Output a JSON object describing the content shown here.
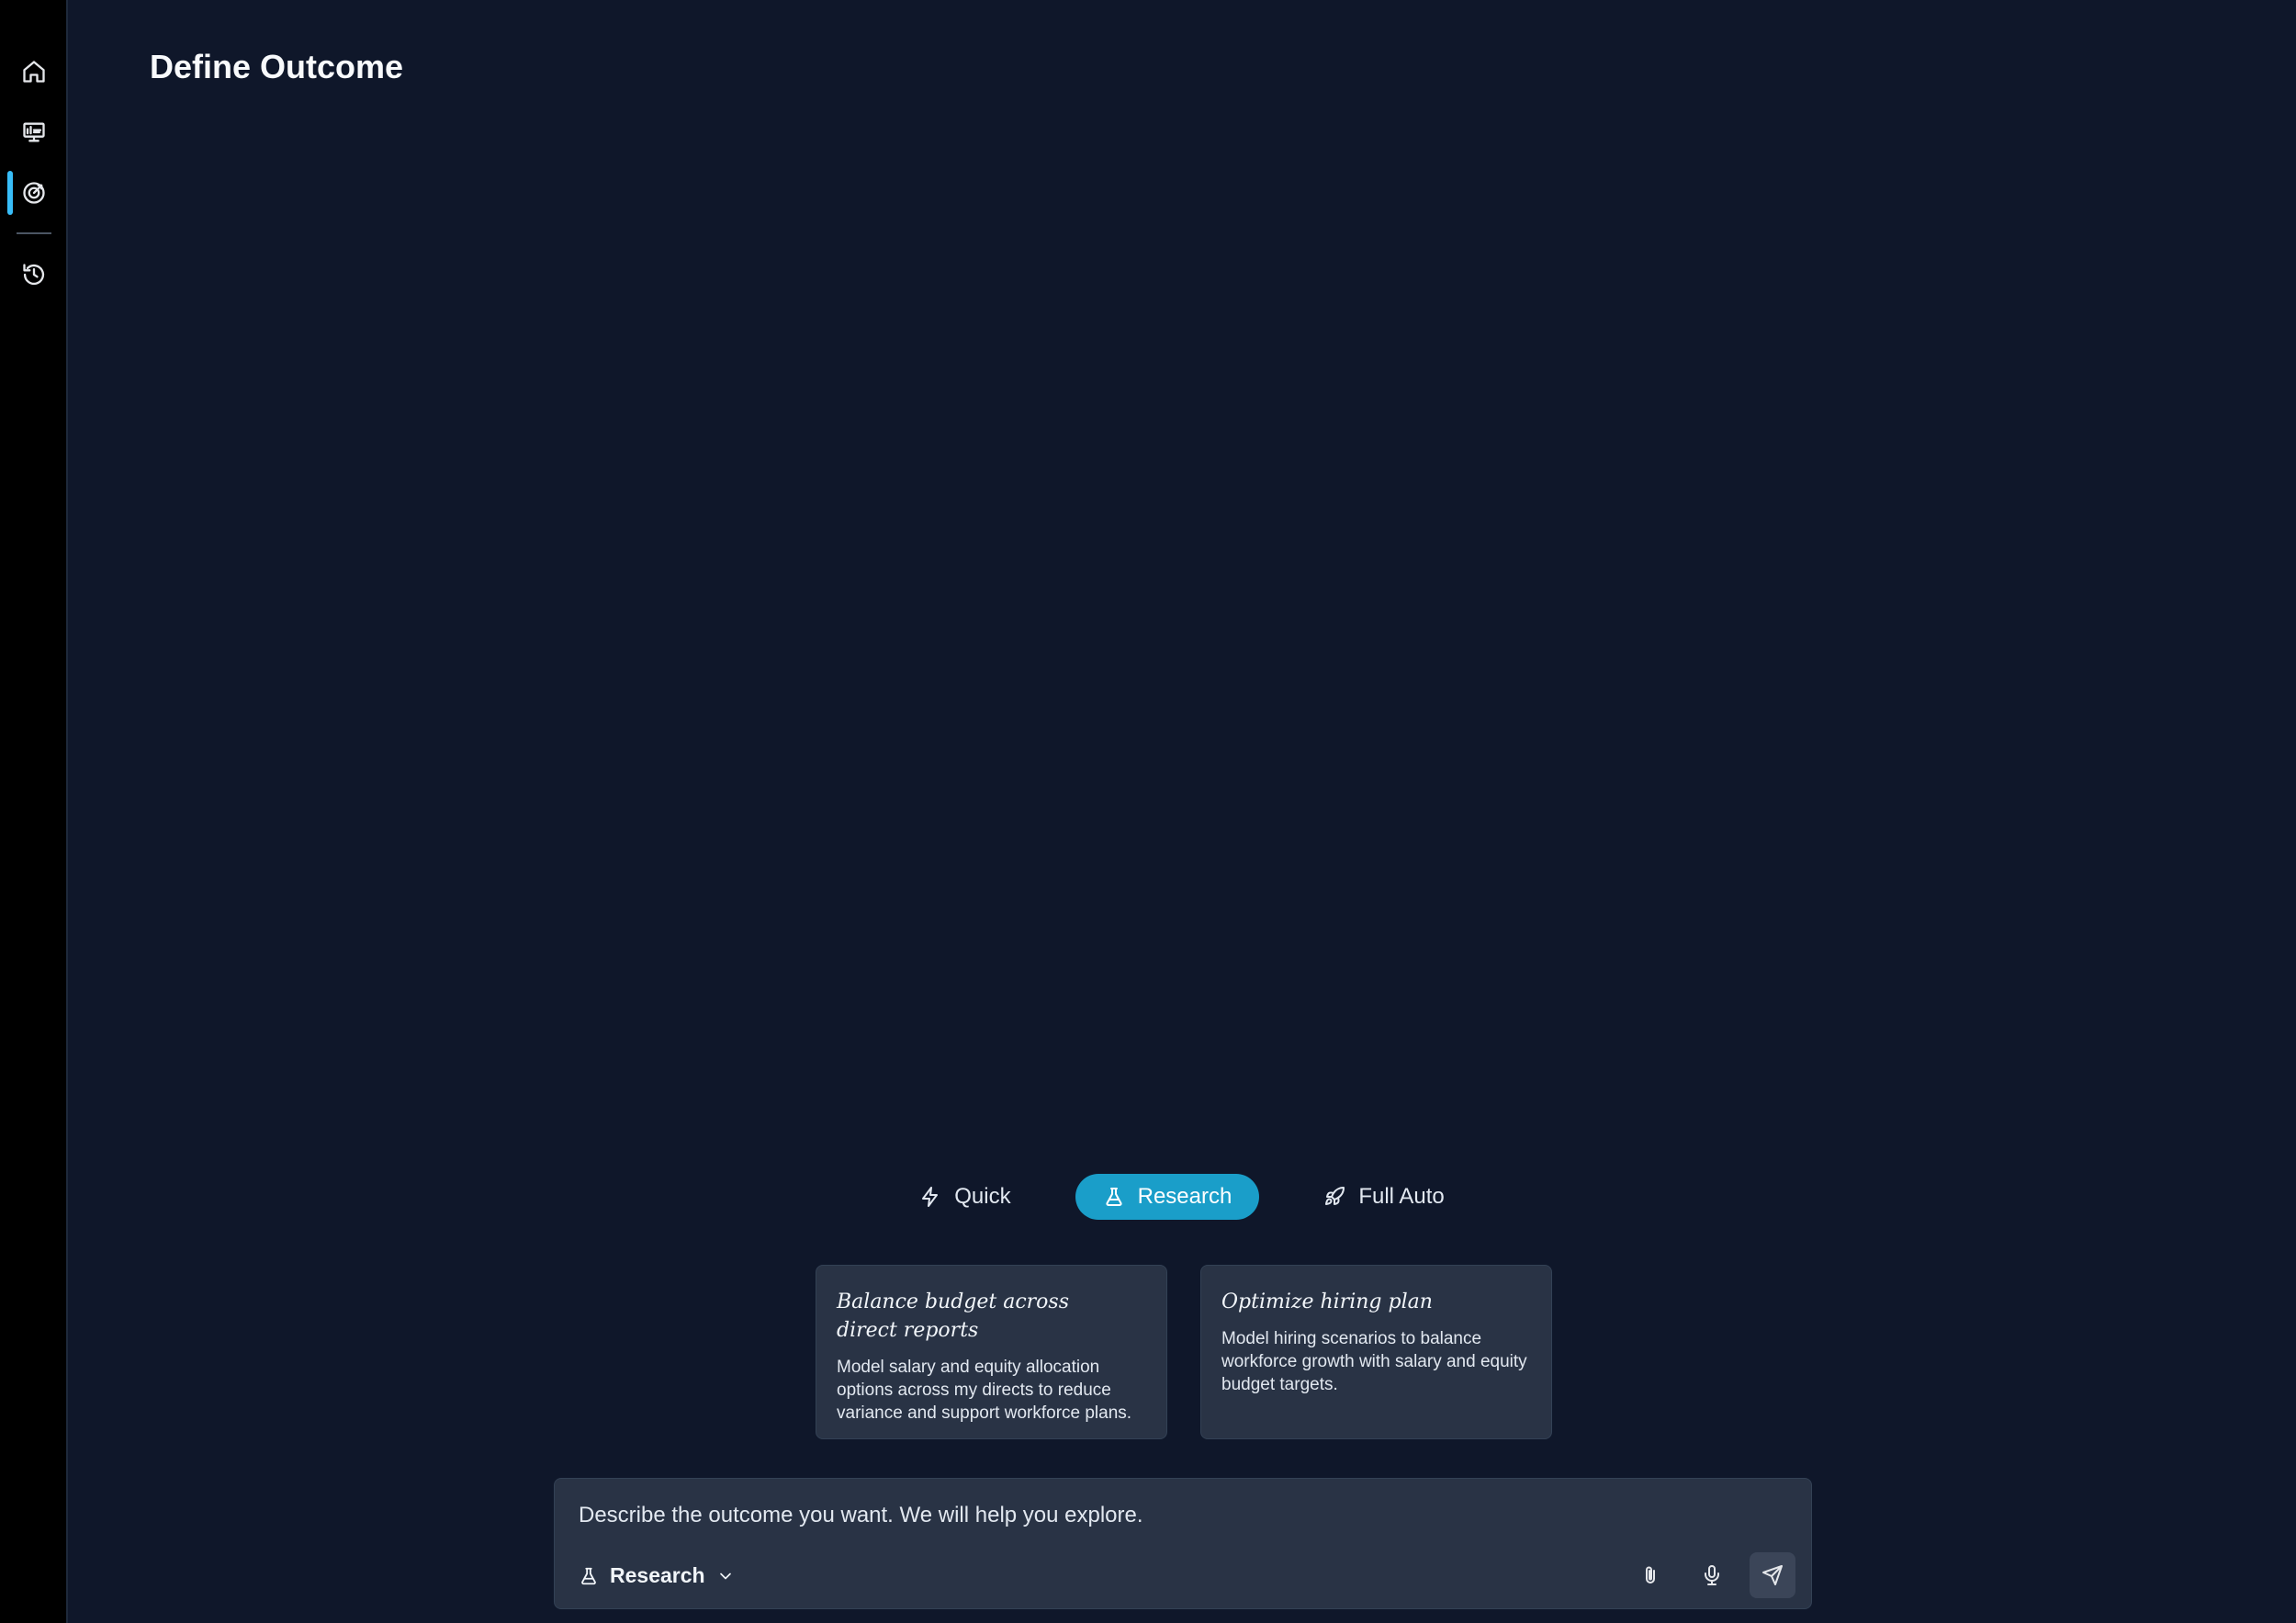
{
  "page": {
    "title": "Define Outcome"
  },
  "sidebar": {
    "items": [
      {
        "icon": "home-icon",
        "active": false
      },
      {
        "icon": "dashboard-icon",
        "active": false
      },
      {
        "icon": "target-icon",
        "active": true
      },
      {
        "icon": "history-icon",
        "active": false
      }
    ]
  },
  "modes": {
    "selected": "Research",
    "items": [
      {
        "label": "Quick",
        "icon": "lightning-icon"
      },
      {
        "label": "Research",
        "icon": "flask-icon"
      },
      {
        "label": "Full Auto",
        "icon": "rocket-icon"
      }
    ]
  },
  "suggestions": [
    {
      "title_line1": "Balance budget across",
      "title_line2": "direct reports",
      "description": "Model salary and equity allocation options across my directs to reduce variance and support workforce plans."
    },
    {
      "title_line1": "Optimize hiring plan",
      "title_line2": "",
      "description": "Model hiring scenarios to balance workforce growth with salary and equity budget targets."
    }
  ],
  "composer": {
    "placeholder": "Describe the outcome you want. We will help you explore.",
    "mode_label": "Research"
  },
  "colors": {
    "background": "#0f172a",
    "sidebar": "#000000",
    "accent": "#1a9ec9",
    "card": "#293345"
  }
}
